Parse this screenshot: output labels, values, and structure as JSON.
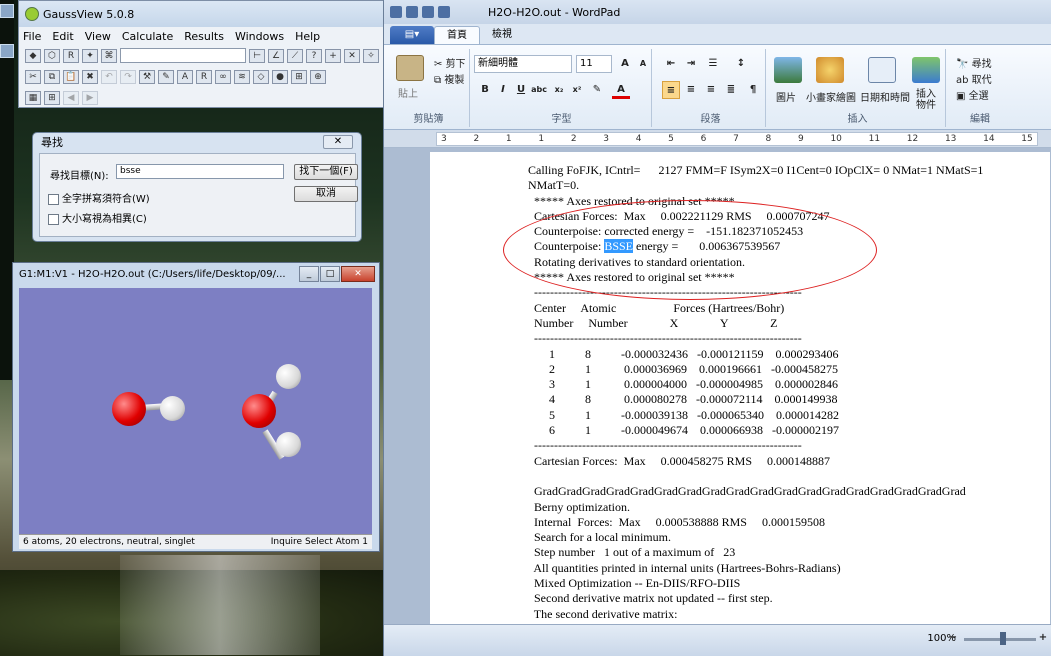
{
  "gaussview": {
    "title": "GaussView 5.0.8",
    "menu": [
      "File",
      "Edit",
      "View",
      "Calculate",
      "Results",
      "Windows",
      "Help"
    ]
  },
  "find_dialog": {
    "title": "尋找",
    "close_label": "✕",
    "target_label": "尋找目標(N):",
    "target_value": "bsse",
    "find_next": "找下一個(F)",
    "cancel": "取消",
    "whole_word": "全字拼寫須符合(W)",
    "match_case": "大小寫視為相異(C)"
  },
  "viewer": {
    "title": "G1:M1:V1 - H2O-H2O.out (C:/Users/life/Desktop/09/...",
    "status_left": "6 atoms, 20 electrons, neutral, singlet",
    "status_mid": "Inquire",
    "status_right": "Select Atom 1"
  },
  "wordpad": {
    "title": "H2O-H2O.out - WordPad",
    "file_tab": "▤▾",
    "tabs": [
      "首頁",
      "檢視"
    ],
    "clipboard": {
      "paste": "貼上",
      "cut": "剪下",
      "copy": "複製",
      "label": "剪貼簿"
    },
    "font": {
      "name": "新細明體",
      "size": "11",
      "label": "字型"
    },
    "paragraph_label": "段落",
    "insert": {
      "picture": "圖片",
      "paint": "小畫家繪圖",
      "datetime": "日期和時間",
      "object": "插入\n物件",
      "label": "插入"
    },
    "editing": {
      "find": "尋找",
      "replace": "取代",
      "selectall": "全選",
      "label": "編輯"
    },
    "ruler": [
      "3",
      "2",
      "1",
      "1",
      "2",
      "3",
      "4",
      "5",
      "6",
      "7",
      "8",
      "9",
      "10",
      "11",
      "12",
      "13",
      "14",
      "15"
    ],
    "zoom": "100%",
    "highlight": "BSSE"
  },
  "document": {
    "lines": [
      "Calling FoFJK, ICntrl=      2127 FMM=F ISym2X=0 I1Cent=0 IOpClX= 0 NMat=1 NMatS=1",
      "NMatT=0.",
      " ***** Axes restored to original set *****",
      " Cartesian Forces:  Max     0.002221129 RMS     0.000707247",
      " Counterpoise: corrected energy =    -151.182371052453",
      " Counterpoise: |BSSE| energy =       0.006367539567",
      " Rotating derivatives to standard orientation.",
      " ***** Axes restored to original set *****",
      " -------------------------------------------------------------------",
      " Center     Atomic                   Forces (Hartrees/Bohr)",
      " Number     Number              X              Y              Z",
      " -------------------------------------------------------------------",
      "      1          8          -0.000032436   -0.000121159    0.000293406",
      "      2          1           0.000036969    0.000196661   -0.000458275",
      "      3          1           0.000004000   -0.000004985    0.000002846",
      "      4          8           0.000080278   -0.000072114    0.000149938",
      "      5          1          -0.000039138   -0.000065340    0.000014282",
      "      6          1          -0.000049674    0.000066938   -0.000002197",
      " -------------------------------------------------------------------",
      " Cartesian Forces:  Max     0.000458275 RMS     0.000148887",
      "",
      " GradGradGradGradGradGradGradGradGradGradGradGradGradGradGradGradGradGrad",
      " Berny optimization.",
      " Internal  Forces:  Max     0.000538888 RMS     0.000159508",
      " Search for a local minimum.",
      " Step number   1 out of a maximum of   23",
      " All quantities printed in internal units (Hartrees-Bohrs-Radians)",
      " Mixed Optimization -- En-DIIS/RFO-DIIS",
      " Second derivative matrix not updated -- first step.",
      " The second derivative matrix:"
    ]
  }
}
